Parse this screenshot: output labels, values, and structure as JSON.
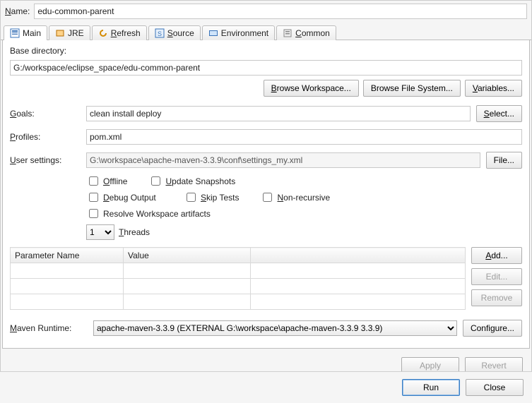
{
  "name": {
    "label": "Name:",
    "value": "edu-common-parent"
  },
  "tabs": [
    {
      "label": "Main",
      "iconColor": "#2e6db5"
    },
    {
      "label": "JRE",
      "iconColor": "#d48a00"
    },
    {
      "label": "Refresh",
      "iconColor": "#d48a00"
    },
    {
      "label": "Source",
      "iconColor": "#2e6db5"
    },
    {
      "label": "Environment",
      "iconColor": "#2e6db5"
    },
    {
      "label": "Common",
      "iconColor": "#555555"
    }
  ],
  "main": {
    "baseDirLabel": "Base directory:",
    "baseDir": "G:/workspace/eclipse_space/edu-common-parent",
    "browseWorkspace": "Browse Workspace...",
    "browseFileSystem": "Browse File System...",
    "variables": "Variables...",
    "goalsLabel": "Goals:",
    "goals": "clean install deploy",
    "select": "Select...",
    "profilesLabel": "Profiles:",
    "profiles": "pom.xml",
    "userSettingsLabel": "User settings:",
    "userSettings": "G:\\workspace\\apache-maven-3.3.9\\conf\\settings_my.xml",
    "fileBtn": "File...",
    "checks": {
      "offline": "Offline",
      "updateSnapshots": "Update Snapshots",
      "debugOutput": "Debug Output",
      "skipTests": "Skip Tests",
      "nonRecursive": "Non-recursive",
      "resolveWorkspace": "Resolve Workspace artifacts"
    },
    "threadsLabel": "Threads",
    "threadsValue": "1",
    "table": {
      "col1": "Parameter Name",
      "col2": "Value",
      "add": "Add...",
      "edit": "Edit...",
      "remove": "Remove"
    },
    "runtimeLabel": "Maven Runtime:",
    "runtimeValue": "apache-maven-3.3.9 (EXTERNAL G:\\workspace\\apache-maven-3.3.9 3.3.9)",
    "configure": "Configure..."
  },
  "apply": "Apply",
  "revert": "Revert",
  "run": "Run",
  "close": "Close"
}
